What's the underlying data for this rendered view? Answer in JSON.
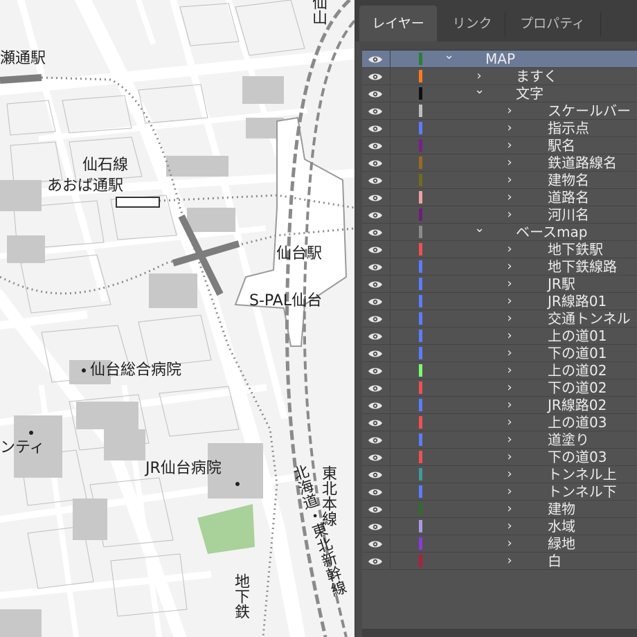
{
  "map": {
    "labels": [
      {
        "id": "station-frag",
        "text": "瀬通駅"
      },
      {
        "id": "sensekisen",
        "text": "仙石線"
      },
      {
        "id": "aobadori",
        "text": "あおば通駅"
      },
      {
        "id": "sendai-station",
        "text": "仙台駅"
      },
      {
        "id": "spal",
        "text": "S-PAL仙台"
      },
      {
        "id": "sogo-hospital",
        "text": "仙台総合病院"
      },
      {
        "id": "city-frag",
        "text": "ンティ"
      },
      {
        "id": "jr-hospital",
        "text": "JR仙台病院"
      }
    ],
    "vertical_labels": [
      {
        "id": "tohoku-honsen",
        "text": "東北本線"
      },
      {
        "id": "hokkaido-shinkansen",
        "text": "北海道・東北新幹線"
      },
      {
        "id": "chikatetsu",
        "text": "地下鉄"
      },
      {
        "id": "top-frag",
        "text": "仙山"
      }
    ],
    "colors": {
      "background": "#f3f3f3",
      "road": "#ffffff",
      "building": "#c8c8c8",
      "greenery": "#a9d19a",
      "rail": "#8a8a8a"
    }
  },
  "panel": {
    "tabs": [
      {
        "id": "layers",
        "label": "レイヤー",
        "active": true
      },
      {
        "id": "links",
        "label": "リンク",
        "active": false
      },
      {
        "id": "properties",
        "label": "プロパティ",
        "active": false
      }
    ],
    "colors": {
      "background": "#4a4a4a",
      "row": "#525252",
      "selected": "#6b7a96",
      "text": "#ececec"
    },
    "layers": [
      {
        "name": "MAP",
        "color": "#2f7d32",
        "level": 0,
        "expanded": true,
        "selected": true
      },
      {
        "name": "ますく",
        "color": "#ff7a1a",
        "level": 1,
        "expanded": false
      },
      {
        "name": "文字",
        "color": "#111111",
        "level": 1,
        "expanded": true
      },
      {
        "name": "スケールバー",
        "color": "#bdbdbd",
        "level": 2,
        "expanded": false
      },
      {
        "name": "指示点",
        "color": "#5c7cff",
        "level": 2,
        "expanded": false
      },
      {
        "name": "駅名",
        "color": "#7a1e8a",
        "level": 2,
        "expanded": false
      },
      {
        "name": "鉄道路線名",
        "color": "#9a6a22",
        "level": 2,
        "expanded": false
      },
      {
        "name": "建物名",
        "color": "#6d6d1e",
        "level": 2,
        "expanded": false
      },
      {
        "name": "道路名",
        "color": "#f0a0a0",
        "level": 2,
        "expanded": false
      },
      {
        "name": "河川名",
        "color": "#6d1e7a",
        "level": 2,
        "expanded": false
      },
      {
        "name": "ベースmap",
        "color": "#8a8a8a",
        "level": 1,
        "expanded": true
      },
      {
        "name": "地下鉄駅",
        "color": "#f05050",
        "level": 2,
        "expanded": false
      },
      {
        "name": "地下鉄線路",
        "color": "#5c7cff",
        "level": 2,
        "expanded": false
      },
      {
        "name": "JR駅",
        "color": "#5c7cff",
        "level": 2,
        "expanded": false
      },
      {
        "name": "JR線路01",
        "color": "#5c7cff",
        "level": 2,
        "expanded": false
      },
      {
        "name": "交通トンネル",
        "color": "#5c7cff",
        "level": 2,
        "expanded": false
      },
      {
        "name": "上の道01",
        "color": "#5c7cff",
        "level": 2,
        "expanded": false
      },
      {
        "name": "下の道01",
        "color": "#5c7cff",
        "level": 2,
        "expanded": false
      },
      {
        "name": "上の道02",
        "color": "#7dff6a",
        "level": 2,
        "expanded": false
      },
      {
        "name": "下の道02",
        "color": "#f05050",
        "level": 2,
        "expanded": false
      },
      {
        "name": "JR線路02",
        "color": "#5c7cff",
        "level": 2,
        "expanded": false
      },
      {
        "name": "上の道03",
        "color": "#f05050",
        "level": 2,
        "expanded": false
      },
      {
        "name": "道塗り",
        "color": "#5c7cff",
        "level": 2,
        "expanded": false
      },
      {
        "name": "下の道03",
        "color": "#f05050",
        "level": 2,
        "expanded": false
      },
      {
        "name": "トンネル上",
        "color": "#3f9a9a",
        "level": 2,
        "expanded": false
      },
      {
        "name": "トンネル下",
        "color": "#5c7cff",
        "level": 2,
        "expanded": false
      },
      {
        "name": "建物",
        "color": "#2f6d2f",
        "level": 2,
        "expanded": false
      },
      {
        "name": "水域",
        "color": "#a89ae0",
        "level": 2,
        "expanded": false
      },
      {
        "name": "緑地",
        "color": "#8a3ad8",
        "level": 2,
        "expanded": false
      },
      {
        "name": "白",
        "color": "#b0203a",
        "level": 2,
        "expanded": false
      }
    ]
  }
}
